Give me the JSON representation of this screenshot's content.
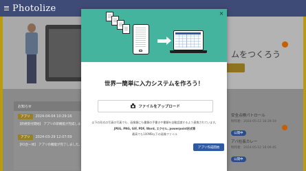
{
  "app": {
    "title": "Photolize"
  },
  "hero": {
    "title": "ムをつくろう",
    "button_label": ""
  },
  "news": {
    "header": "お知らせ",
    "items": [
      {
        "tag": "アプリ",
        "date": "2024-04-04 10:29:16",
        "text": "【新規受付開始】 アプリの新機能が完成しました"
      },
      {
        "tag": "アプリ",
        "date": "2024-03-29 12:07:59",
        "text": "【R5合一体】 アプリの機能が完了しました。"
      }
    ]
  },
  "sidebar_list": {
    "items": [
      {
        "title": "安全点検パトロール",
        "date": "制作者：2024-05-12 16:29:19",
        "tag": "公開中"
      },
      {
        "title": "アバ社長カレー",
        "date": "制作者：2024-05-12 16:09:45",
        "tag": "公開中"
      }
    ]
  },
  "modal": {
    "close_icon": "×",
    "title": "世界一簡単に入力システムを作ろう！",
    "upload_label": "ファイルをアップロード",
    "note_1": "以下の形式の写真の写真でも、画像類にも書類の手書きや書類を自動認識するよう連携されています。",
    "note_2": "JPEG, PNG, GIF, PDF, Word, エクセル, powerpoint形式等",
    "note_3": "最高でも100MB以下の画像ファイル",
    "create_label": "アプリ作成開始"
  },
  "colors": {
    "modal_header": "#45b49f",
    "primary_button": "#2f5aa3",
    "topbar": "#3e4b76"
  }
}
